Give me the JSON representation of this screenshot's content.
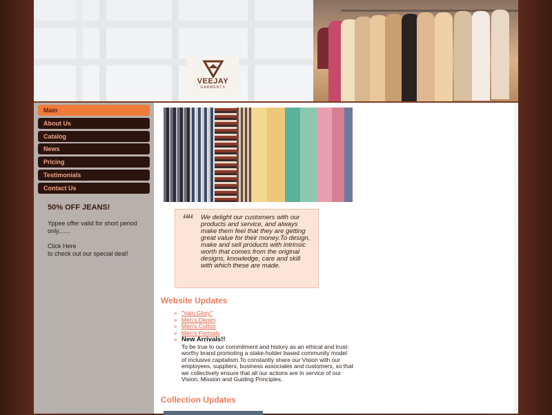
{
  "logo": {
    "name": "VEEJAY",
    "tagline": "GARMENTS"
  },
  "slider": {
    "count": 5,
    "active_index": 0
  },
  "nav": {
    "items": [
      {
        "label": "Main",
        "active": true
      },
      {
        "label": "About Us",
        "active": false
      },
      {
        "label": "Catalog",
        "active": false
      },
      {
        "label": "News",
        "active": false
      },
      {
        "label": "Pricing",
        "active": false
      },
      {
        "label": "Testimonials",
        "active": false
      },
      {
        "label": "Contact Us",
        "active": false
      }
    ]
  },
  "promo": {
    "title": "50% OFF JEANS!",
    "offer": "Yppee offer valid for short period only.......",
    "click": "Click Here",
    "click_desc": "to check out our special deal!"
  },
  "quote": {
    "mark": "““",
    "text": "We delight our customers with our products and service, and always make them feel that they are getting great value for their money.To design, make and sell products with intrinsic worth that comes from the original designs, knowledge, care and skill with which these are made."
  },
  "website_updates": {
    "title": "Website Updates",
    "bullet": "»",
    "links": [
      "\"Vain Glory\"",
      " Men's Denim",
      "Men's Cotton",
      "Men's Formals"
    ],
    "arrivals_title": "New Arrivals!!",
    "arrivals_body": "To be true to our commitment and history as an ethical and trust-worthy brand promoting a stake-holder based community model of inclusive capitalism.To constantly share our Vision with our employees, suppliers, business associates and customers, so that we collectively ensure that all our actions are in service of our Vision, Mission and Guiding Principles."
  },
  "collection_updates": {
    "title": "Collection Updates"
  },
  "colors": {
    "accent": "#f07a3a",
    "nav_bg": "#2b140e",
    "nav_text": "#f0a58a",
    "heading": "#f07a5a",
    "sidebar_bg": "#b8b0ad",
    "quote_bg": "#fde4d8"
  }
}
